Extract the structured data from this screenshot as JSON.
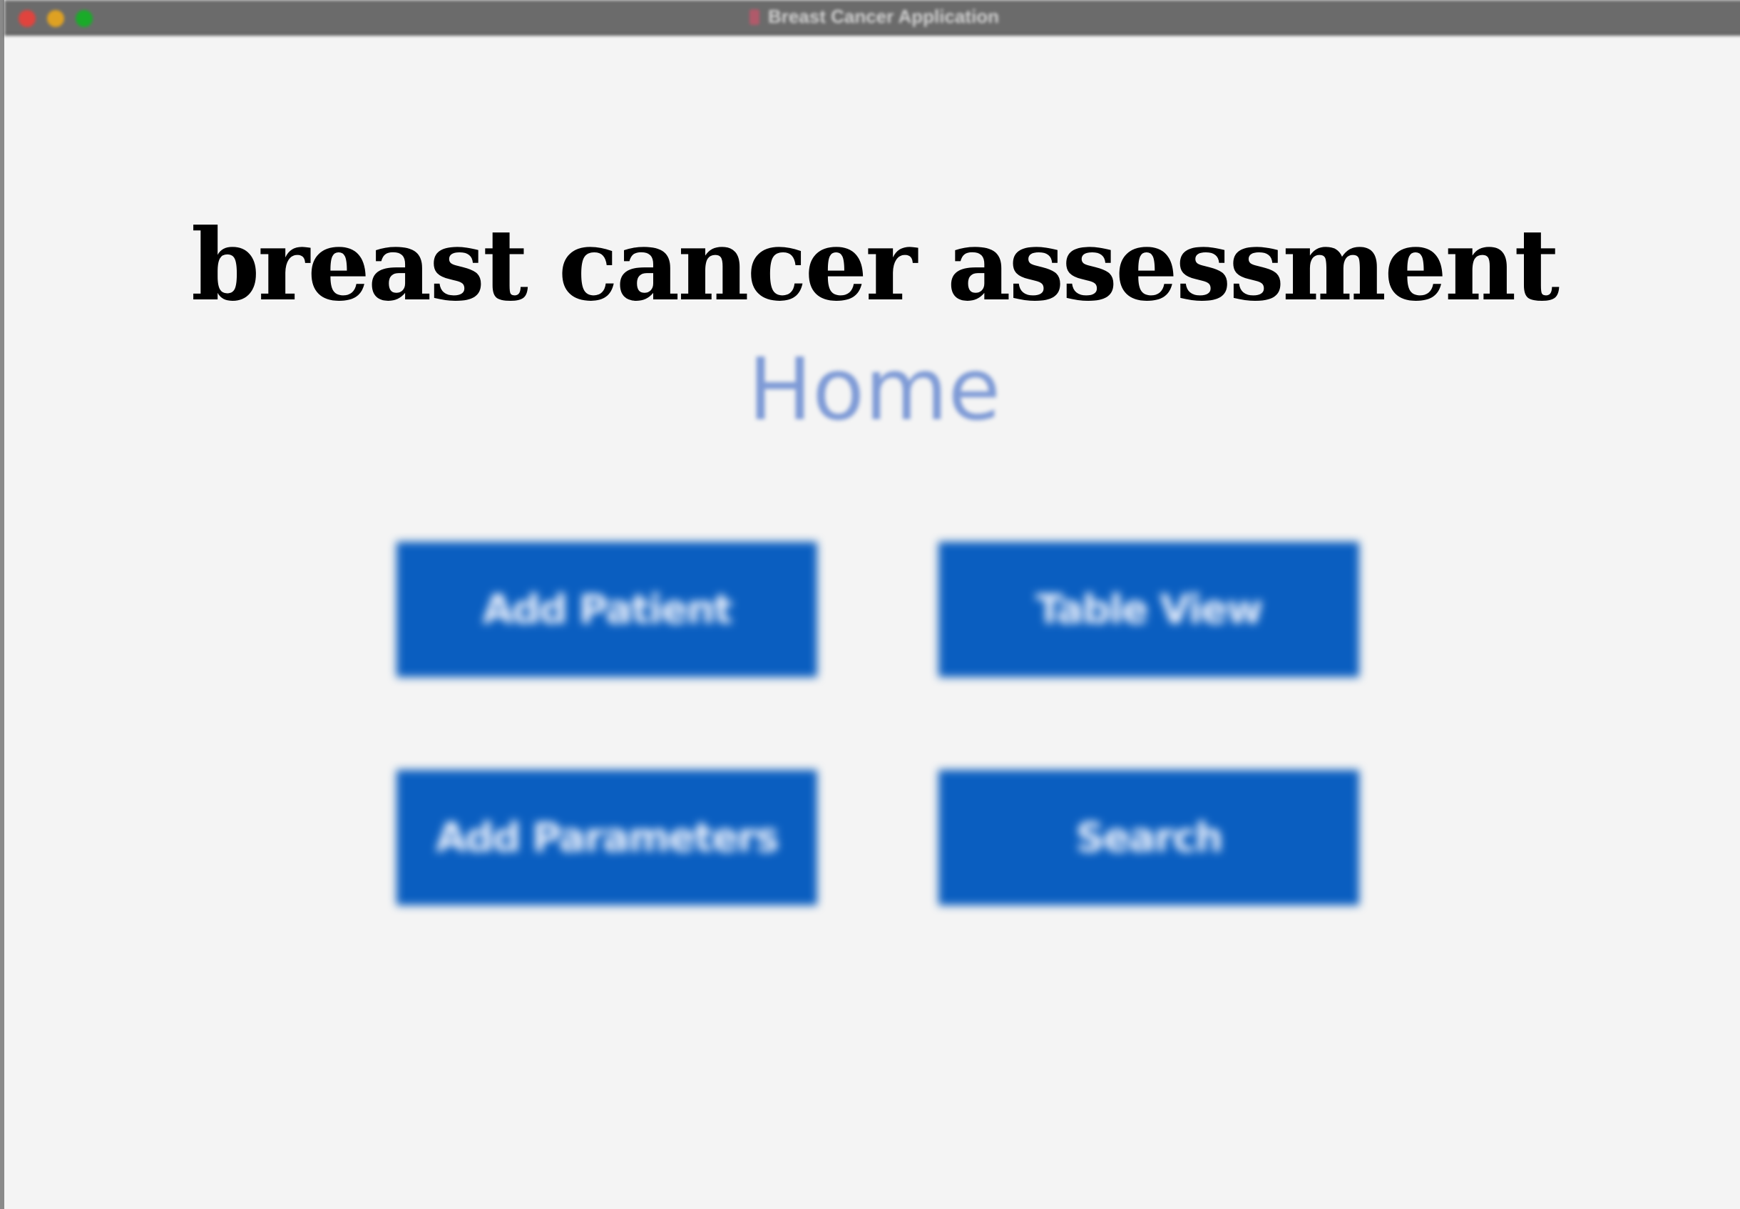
{
  "window": {
    "title": "Breast Cancer Application"
  },
  "page": {
    "heading": "breast cancer assessment",
    "subheading": "Home"
  },
  "buttons": {
    "add_patient": "Add Patient",
    "table_view": "Table View",
    "add_parameters": "Add Parameters",
    "search": "Search"
  },
  "colors": {
    "button_bg": "#0a5ec0",
    "subheading": "#7f9bd6",
    "window_bg": "#f4f4f4",
    "titlebar": "#6b6b6b"
  }
}
